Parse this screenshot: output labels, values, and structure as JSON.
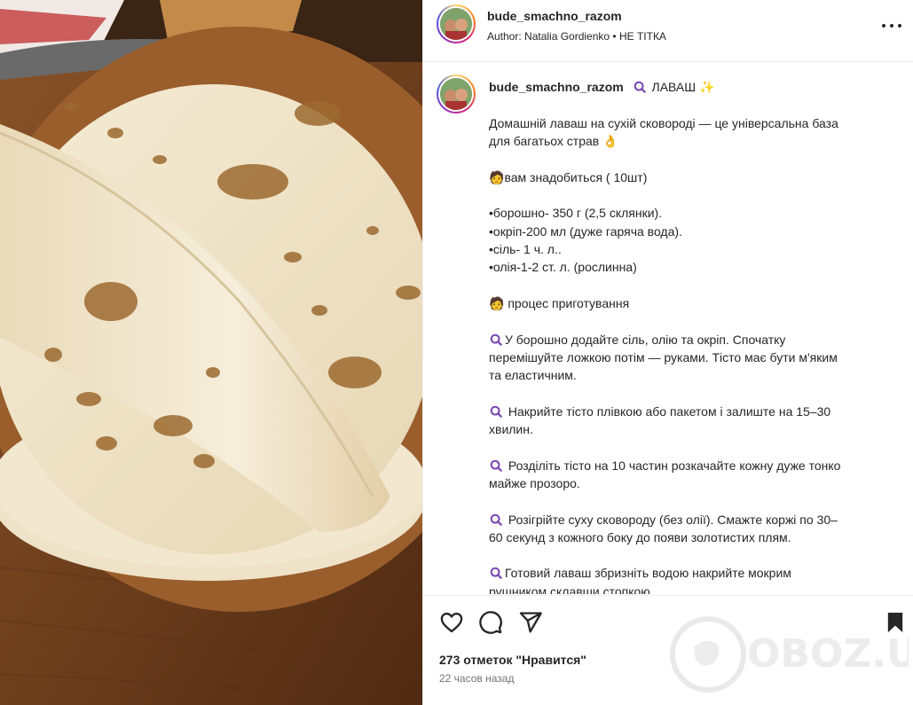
{
  "post": {
    "author_username": "bude_smachno_razom",
    "attribution": "Author: Natalia Gordienko • НЕ ТІТКА"
  },
  "caption": {
    "username": "bude_smachno_razom",
    "title": "ЛАВАШ",
    "lines": [
      "Домашній лаваш на сухій сковороді — це універсальна база",
      "для багатьох страв",
      "",
      "вам знадобиться ( 10шт)",
      "",
      "•борошно- 350 г (2,5 склянки).",
      "•окріп-200 мл (дуже гаряча вода).",
      "•сіль- 1 ч. л..",
      "•олія-1-2 ст. л. (рослинна)",
      "",
      "процес приготування",
      "",
      "У борошно додайте сіль, олію та окріп. Спочатку",
      "перемішуйте ложкою потім — руками. Тісто має бути м'яким",
      "та еластичним.",
      "",
      "Накрийте тісто плівкою або пакетом і залиште на 15–30",
      "хвилин.",
      "",
      "Розділіть тісто на 10 частин розкачайте кожну дуже тонко",
      "майже прозоро.",
      "",
      "Розігрійте суху сковороду (без олії). Смажте коржі по 30–",
      "60 секунд з кожного боку до появи золотистих плям.",
      "",
      "Готовий лаваш збризніть водою накрийте мокрим",
      "рушником склавши стопкою."
    ]
  },
  "engagement": {
    "likes": "273 отметок \"Нравится\"",
    "time": "22 часов назад"
  },
  "watermark": {
    "text": "OBOZ.UA"
  },
  "icons": {
    "like": "heart-icon",
    "comment": "comment-icon",
    "share": "share-icon",
    "save": "bookmark-icon",
    "more": "more-options-icon",
    "emoji_search": "magnifier-emoji",
    "emoji_sparkle": "sparkles-emoji",
    "emoji_ok": "ok-hand-emoji",
    "emoji_person": "person-emoji"
  },
  "colors": {
    "text": "#262626",
    "muted": "#737373",
    "divider": "#efefef",
    "emoji_purple": "#7b4bb3"
  }
}
